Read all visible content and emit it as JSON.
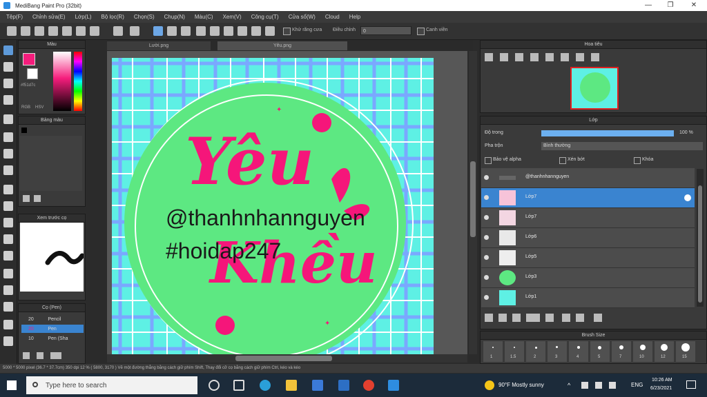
{
  "window": {
    "title": "MediBang Paint Pro (32bit)"
  },
  "menu": [
    "Tệp(F)",
    "Chỉnh sửa(E)",
    "Lớp(L)",
    "Bộ lọc(R)",
    "Chọn(S)",
    "Chụp(N)",
    "Màu(C)",
    "Xem(V)",
    "Công cụ(T)",
    "Cửa sổ(W)",
    "Cloud",
    "Help"
  ],
  "toolbar": {
    "antialias_label": "Khử răng cưa",
    "correction_label": "Điều chỉnh",
    "correction_value": "0",
    "snap_label": "Canh viền"
  },
  "color_panel": {
    "title": "Màu",
    "hex": "#f51d7c",
    "labels": [
      "RGB",
      "HSV"
    ]
  },
  "palette_panel": {
    "title": "Bảng màu"
  },
  "brush_preview_panel": {
    "title": "Xem trước cọ"
  },
  "brush_panel": {
    "title": "Cọ (Pen)",
    "items": [
      {
        "size": "20",
        "name": "Pencil"
      },
      {
        "size": "20",
        "name": "Pen"
      },
      {
        "size": "10",
        "name": "Pen (Sha"
      }
    ]
  },
  "tabs": [
    "Lười.png",
    "Yêu.png"
  ],
  "canvas": {
    "bg_color": "#5ef0e4",
    "grid_color": "#7aa8ff",
    "circle_color": "#5de882",
    "text_color": "#f5167a",
    "lettering": [
      "Yêu",
      "Khều"
    ],
    "watermark_1": "@thanhnhannguyen",
    "watermark_2": "#hoidap247"
  },
  "navigator": {
    "title": "Hoa tiêu"
  },
  "layer_panel": {
    "title": "Lớp",
    "opacity_label": "Độ trong",
    "opacity_value": "100 %",
    "blend_label": "Pha trộn",
    "blend_value": "Bình thường",
    "checks": [
      "Bảo vệ alpha",
      "Xén bớt",
      "Khóa"
    ],
    "layers": [
      {
        "name": "@thanhnhannguyen",
        "thumb": "text"
      },
      {
        "name": "Lớp7",
        "thumb": "#f7c3d9",
        "selected": true
      },
      {
        "name": "Lớp7",
        "thumb": "#f3d6e2"
      },
      {
        "name": "Lớp6",
        "thumb": "#e9e9e9"
      },
      {
        "name": "Lớp5",
        "thumb": "#eeeeee"
      },
      {
        "name": "Lớp3",
        "thumb": "#5de882"
      },
      {
        "name": "Lớp1",
        "thumb": "#5ef0e4"
      }
    ]
  },
  "brush_size_panel": {
    "title": "Brush Size",
    "sizes": [
      "1",
      "1.5",
      "2",
      "3",
      "4",
      "5",
      "7",
      "10",
      "12",
      "15"
    ]
  },
  "statusbar": {
    "text": "5000 * 5000 pixel  (36.7 * 37.7cm)  350 dpi  12 %  ( 5800, 3170 )  Vẽ một đường thẳng bằng cách giữ phím Shift, Thay đổi cỡ cọ bằng cách giữ phím Ctrl, kéo và kéo"
  },
  "taskbar": {
    "search_placeholder": "Type here to search",
    "weather": "90°F  Mostly sunny",
    "lang": "ENG",
    "time": "10:26 AM",
    "date": "6/23/2021"
  }
}
